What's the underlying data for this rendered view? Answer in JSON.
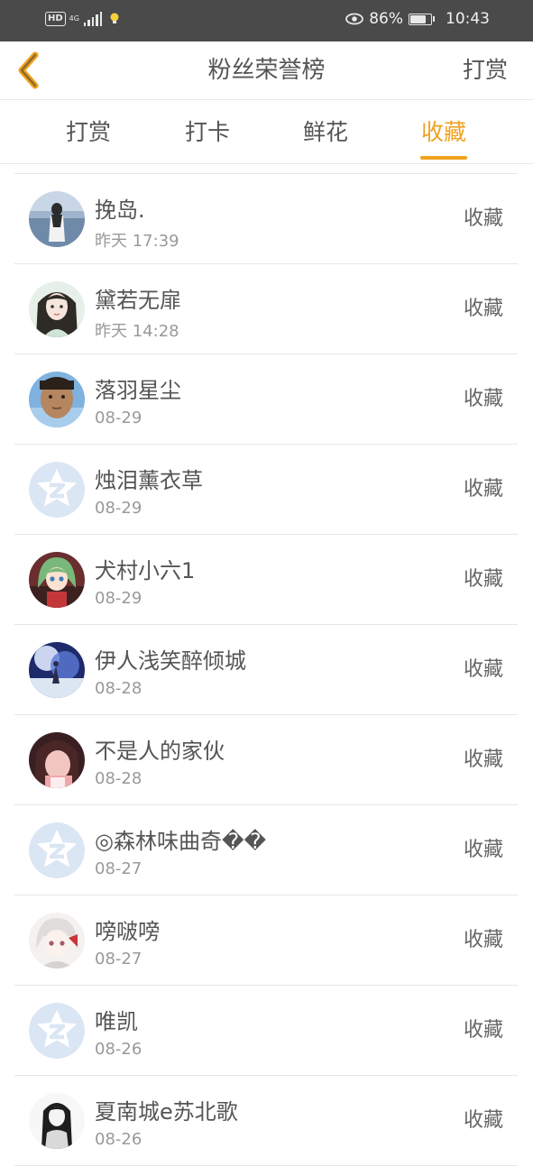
{
  "status_bar": {
    "hd": "HD",
    "network": "4G",
    "battery_percent": "86%",
    "battery_level": 0.86,
    "time": "10:43"
  },
  "header": {
    "back_icon": "chevron-left-icon",
    "title": "粉丝荣誉榜",
    "action": "打赏"
  },
  "tabs": [
    {
      "label": "打赏",
      "active": false
    },
    {
      "label": "打卡",
      "active": false
    },
    {
      "label": "鲜花",
      "active": false
    },
    {
      "label": "收藏",
      "active": true
    }
  ],
  "colors": {
    "accent": "#f0a21e",
    "text": "#555555",
    "subtext": "#999999",
    "divider": "#e6e6e6",
    "status_bar": "#4a4a4a",
    "default_avatar": "#dbe6f4"
  },
  "fans": [
    {
      "name": "挽岛.",
      "time": "昨天 17:39",
      "action": "收藏",
      "avatar": "photo-avatar"
    },
    {
      "name": "黛若无扉",
      "time": "昨天 14:28",
      "action": "收藏",
      "avatar": "photo-avatar"
    },
    {
      "name": "落羽星尘",
      "time": "08-29",
      "action": "收藏",
      "avatar": "photo-avatar"
    },
    {
      "name": "烛泪薰衣草",
      "time": "08-29",
      "action": "收藏",
      "avatar": "default-avatar-icon"
    },
    {
      "name": "犬村小六1",
      "time": "08-29",
      "action": "收藏",
      "avatar": "photo-avatar"
    },
    {
      "name": "伊人浅笑醉倾城",
      "time": "08-28",
      "action": "收藏",
      "avatar": "photo-avatar"
    },
    {
      "name": "不是人的家伙",
      "time": "08-28",
      "action": "收藏",
      "avatar": "photo-avatar"
    },
    {
      "name": "◎森林味曲奇��",
      "time": "08-27",
      "action": "收藏",
      "avatar": "default-avatar-icon"
    },
    {
      "name": "嗙啵嗙",
      "time": "08-27",
      "action": "收藏",
      "avatar": "photo-avatar"
    },
    {
      "name": "唯凯",
      "time": "08-26",
      "action": "收藏",
      "avatar": "default-avatar-icon"
    },
    {
      "name": "夏南城e苏北歌",
      "time": "08-26",
      "action": "收藏",
      "avatar": "photo-avatar"
    }
  ]
}
